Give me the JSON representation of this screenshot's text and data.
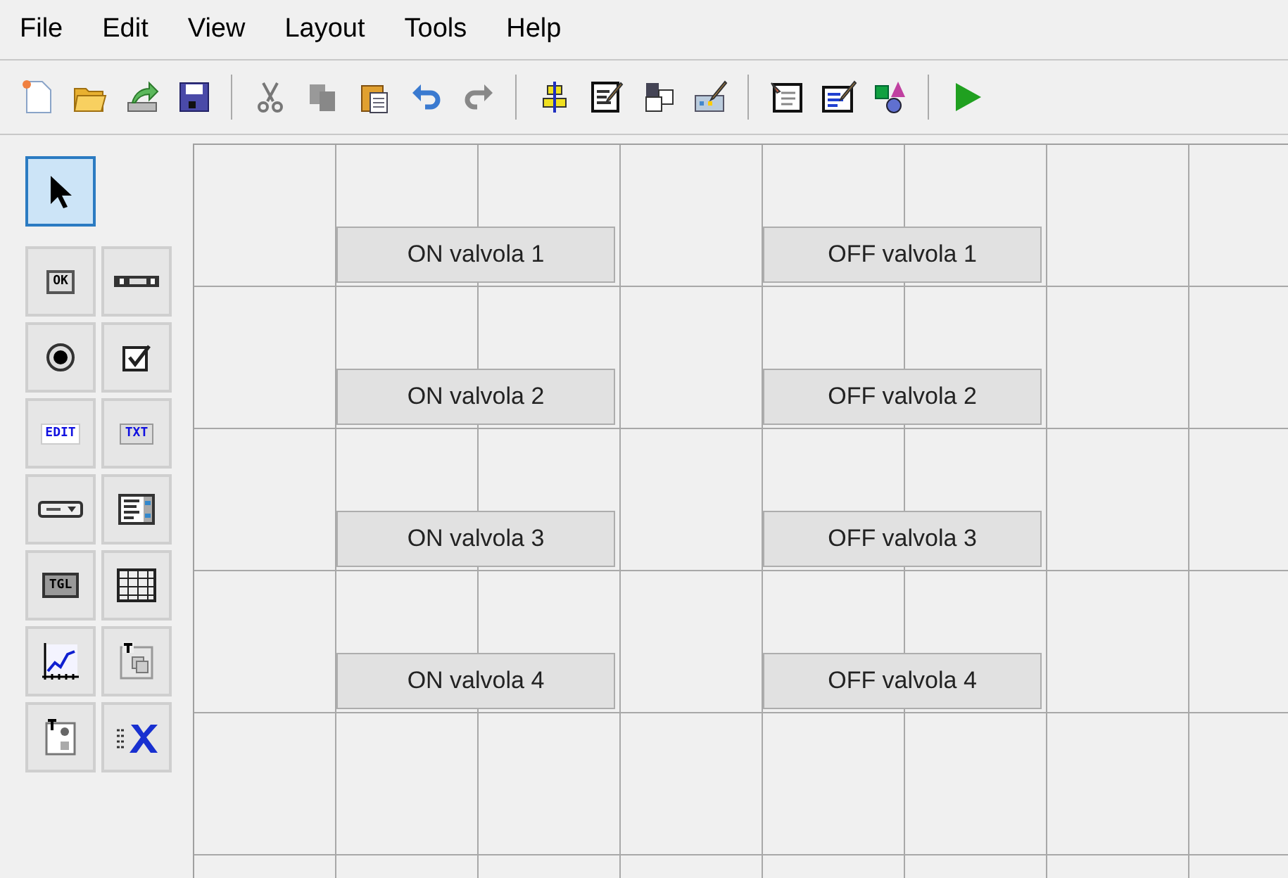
{
  "menu": [
    "File",
    "Edit",
    "View",
    "Layout",
    "Tools",
    "Help"
  ],
  "palette": [
    {
      "kind": "pointer",
      "selected": true
    },
    {
      "kind": "push",
      "label": "OK",
      "selected": false
    },
    {
      "kind": "slider",
      "selected": false
    },
    {
      "kind": "radio",
      "selected": false
    },
    {
      "kind": "check",
      "selected": false
    },
    {
      "kind": "edit",
      "label": "EDIT",
      "selected": false
    },
    {
      "kind": "text",
      "label": "TXT",
      "selected": false
    },
    {
      "kind": "popup",
      "selected": false
    },
    {
      "kind": "listbox",
      "selected": false
    },
    {
      "kind": "toggle",
      "label": "TGL",
      "selected": false
    },
    {
      "kind": "table",
      "selected": false
    },
    {
      "kind": "axes",
      "selected": false
    },
    {
      "kind": "panel",
      "selected": false
    },
    {
      "kind": "buttongroup",
      "selected": false
    },
    {
      "kind": "activex",
      "selected": false
    }
  ],
  "button_rows": [
    {
      "on": "ON valvola 1",
      "off": "OFF valvola 1"
    },
    {
      "on": "ON valvola 2",
      "off": "OFF valvola 2"
    },
    {
      "on": "ON valvola 3",
      "off": "OFF valvola 3"
    },
    {
      "on": "ON valvola 4",
      "off": "OFF valvola 4"
    }
  ]
}
